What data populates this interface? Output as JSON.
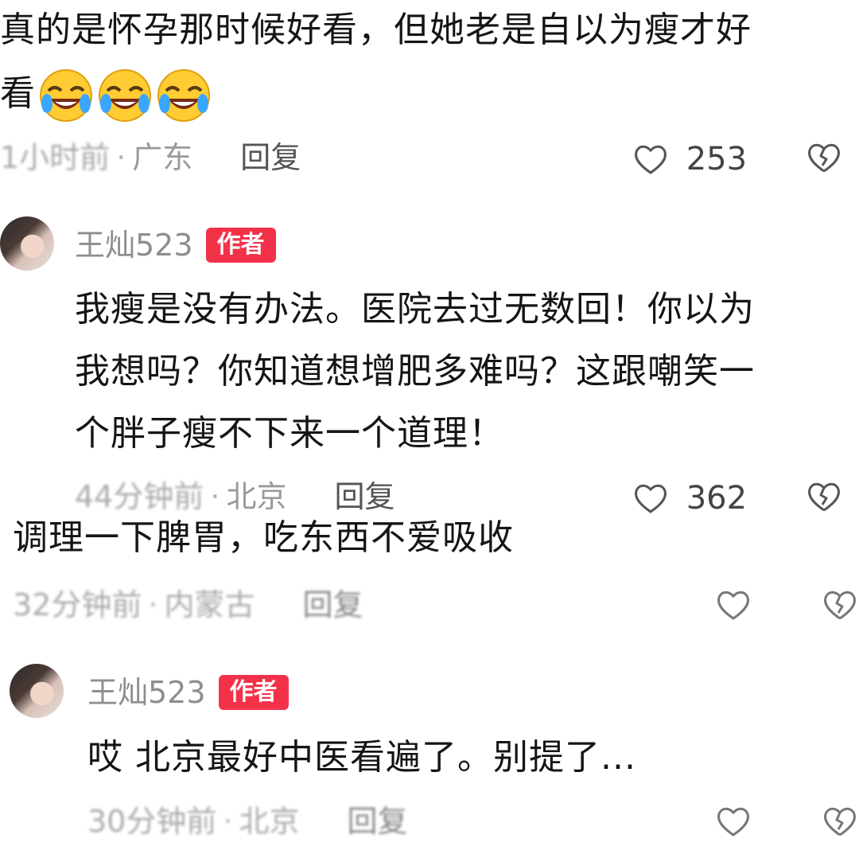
{
  "comments": [
    {
      "text_line1": "真的是怀孕那时候好看，但她老是自以为瘦才好",
      "text_line2": "看",
      "emoji": [
        "laugh-cry-emoji",
        "laugh-cry-emoji",
        "laugh-cry-emoji"
      ],
      "time": "1小时前",
      "location": "广东",
      "reply_label": "回复",
      "likes": "253"
    },
    {
      "author": "王灿523",
      "badge": "作者",
      "lines": [
        "我瘦是没有办法。医院去过无数回！你以为",
        "我想吗？你知道想增肥多难吗？这跟嘲笑一",
        "个胖子瘦不下来一个道理！"
      ],
      "time": "44分钟前",
      "location": "北京",
      "reply_label": "回复",
      "likes": "362"
    },
    {
      "text": "调理一下脾胃，吃东西不爱吸收",
      "time": "32分钟前",
      "location": "内蒙古",
      "reply_label": "回复",
      "likes": ""
    },
    {
      "author": "王灿523",
      "badge": "作者",
      "text": "哎 北京最好中医看遍了。别提了...",
      "time": "30分钟前",
      "location": "北京",
      "reply_label": "回复"
    }
  ],
  "icons": {
    "like": "heart-outline-icon",
    "dislike": "broken-heart-icon"
  },
  "colors": {
    "badge": "#f3324a",
    "meta": "#9a9a9a"
  }
}
